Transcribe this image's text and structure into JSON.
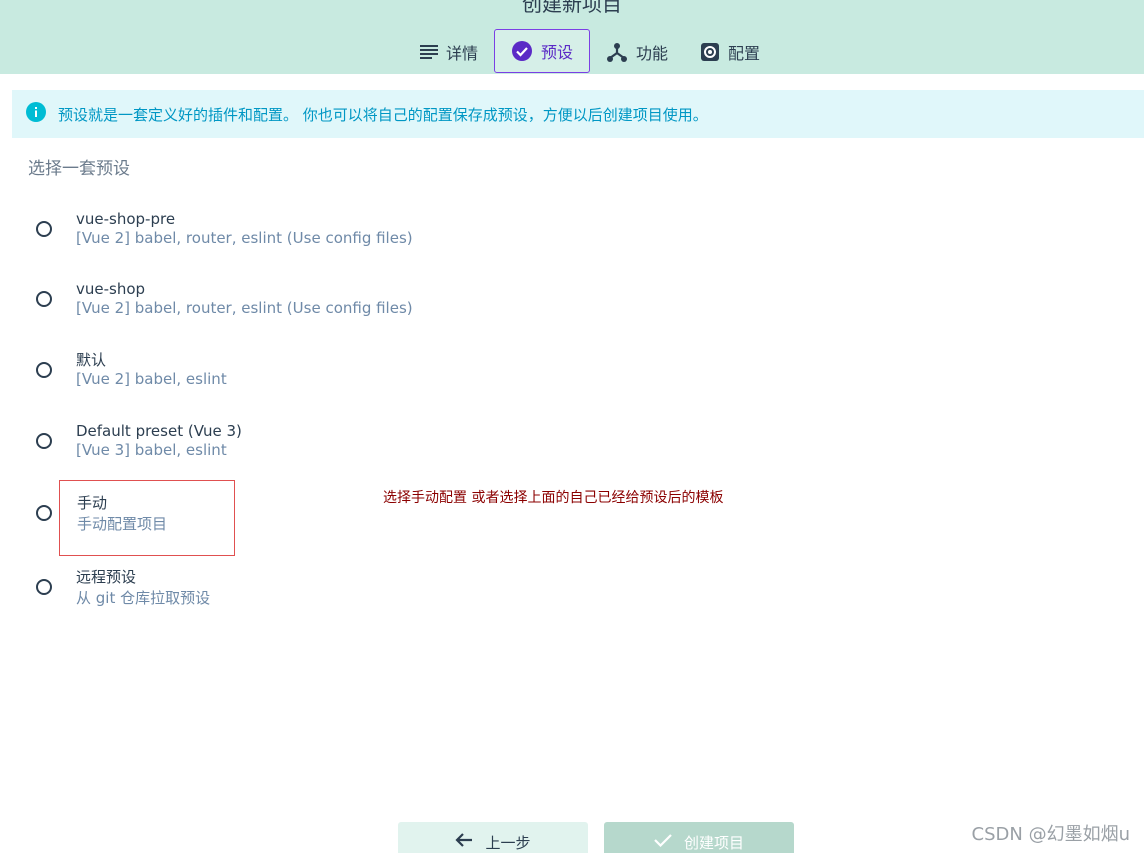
{
  "header": {
    "title": "创建新项目",
    "tabs": [
      {
        "label": "详情",
        "icon": "list-icon",
        "active": false
      },
      {
        "label": "预设",
        "icon": "check-circle-icon",
        "active": true
      },
      {
        "label": "功能",
        "icon": "fork-icon",
        "active": false
      },
      {
        "label": "配置",
        "icon": "gear-icon",
        "active": false
      }
    ]
  },
  "info": {
    "icon": "info-icon",
    "text": "预设就是一套定义好的插件和配置。 你也可以将自己的配置保存成预设，方便以后创建项目使用。"
  },
  "section": {
    "title": "选择一套预设"
  },
  "presets": [
    {
      "name": "vue-shop-pre",
      "desc": "[Vue 2] babel, router, eslint (Use config files)"
    },
    {
      "name": "vue-shop",
      "desc": "[Vue 2] babel, router, eslint (Use config files)"
    },
    {
      "name": "默认",
      "desc": "[Vue 2] babel, eslint"
    },
    {
      "name": "Default preset (Vue 3)",
      "desc": "[Vue 3] babel, eslint"
    },
    {
      "name": "手动",
      "desc": "手动配置项目"
    },
    {
      "name": "远程预设",
      "desc": "从 git 仓库拉取预设"
    }
  ],
  "annotation": {
    "text": "选择手动配置 或者选择上面的自己已经给预设后的模板",
    "color": "#8b0000"
  },
  "footer": {
    "prev_label": "上一步",
    "create_label": "创建项目"
  },
  "watermark": {
    "text": "CSDN @幻墨如烟u"
  },
  "colors": {
    "header_bg": "#c8eae0",
    "accent": "#7b3fe4",
    "info_bg": "#e0f7fa",
    "info_text": "#0097c4"
  }
}
